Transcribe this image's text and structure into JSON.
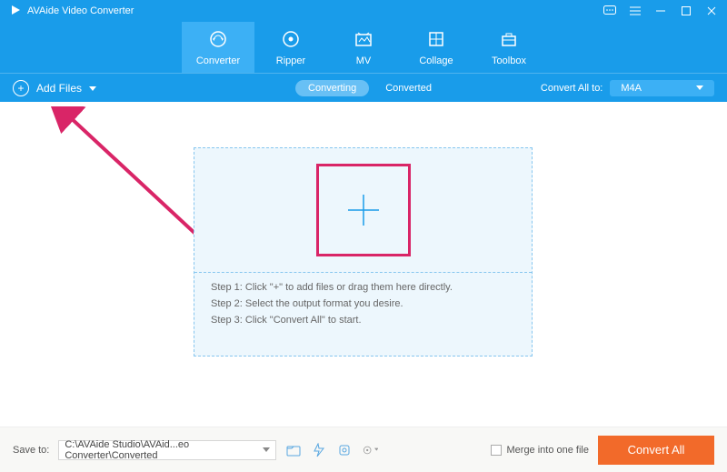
{
  "title": "AVAide Video Converter",
  "nav": {
    "items": [
      {
        "label": "Converter"
      },
      {
        "label": "Ripper"
      },
      {
        "label": "MV"
      },
      {
        "label": "Collage"
      },
      {
        "label": "Toolbox"
      }
    ]
  },
  "secbar": {
    "add_files_label": "Add Files",
    "converting_label": "Converting",
    "converted_label": "Converted",
    "convert_all_to_label": "Convert All to:",
    "selected_format": "M4A"
  },
  "drop": {
    "step1": "Step 1: Click \"+\" to add files or drag them here directly.",
    "step2": "Step 2: Select the output format you desire.",
    "step3": "Step 3: Click \"Convert All\" to start."
  },
  "footer": {
    "save_to_label": "Save to:",
    "save_path": "C:\\AVAide Studio\\AVAid...eo Converter\\Converted",
    "merge_label": "Merge into one file",
    "convert_all_btn": "Convert All"
  },
  "colors": {
    "primary": "#199cea",
    "accent": "#f26a2a",
    "highlight": "#d92567"
  }
}
